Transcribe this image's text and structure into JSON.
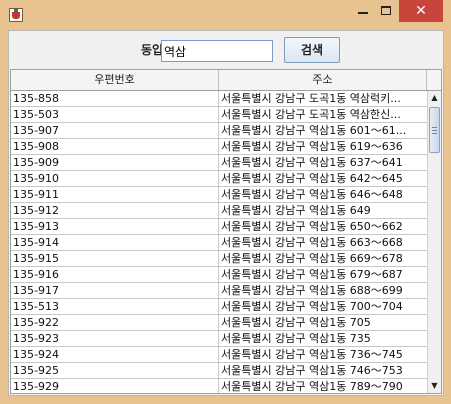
{
  "window": {
    "title": "",
    "controls": {
      "minimize": "—",
      "maximize": "□",
      "close": "✕"
    }
  },
  "search": {
    "label": "동입력:",
    "value": "역삼",
    "button_label": "검색"
  },
  "table": {
    "columns": [
      "우편번호",
      "주소"
    ],
    "rows": [
      {
        "zip": "135-858",
        "address": "서울특별시 강남구 도곡1동 역삼럭키..."
      },
      {
        "zip": "135-503",
        "address": "서울특별시 강남구 도곡1동 역삼한신..."
      },
      {
        "zip": "135-907",
        "address": "서울특별시 강남구 역삼1동 601～61..."
      },
      {
        "zip": "135-908",
        "address": "서울특별시 강남구 역삼1동 619～636"
      },
      {
        "zip": "135-909",
        "address": "서울특별시 강남구 역삼1동 637～641"
      },
      {
        "zip": "135-910",
        "address": "서울특별시 강남구 역삼1동 642～645"
      },
      {
        "zip": "135-911",
        "address": "서울특별시 강남구 역삼1동 646～648"
      },
      {
        "zip": "135-912",
        "address": "서울특별시 강남구 역삼1동 649"
      },
      {
        "zip": "135-913",
        "address": "서울특별시 강남구 역삼1동 650～662"
      },
      {
        "zip": "135-914",
        "address": "서울특별시 강남구 역삼1동 663～668"
      },
      {
        "zip": "135-915",
        "address": "서울특별시 강남구 역삼1동 669～678"
      },
      {
        "zip": "135-916",
        "address": "서울특별시 강남구 역삼1동 679～687"
      },
      {
        "zip": "135-917",
        "address": "서울특별시 강남구 역삼1동 688～699"
      },
      {
        "zip": "135-513",
        "address": "서울특별시 강남구 역삼1동 700～704"
      },
      {
        "zip": "135-922",
        "address": "서울특별시 강남구 역삼1동 705"
      },
      {
        "zip": "135-923",
        "address": "서울특별시 강남구 역삼1동 735"
      },
      {
        "zip": "135-924",
        "address": "서울특별시 강남구 역삼1동 736～745"
      },
      {
        "zip": "135-925",
        "address": "서울특별시 강남구 역삼1동 746～753"
      },
      {
        "zip": "135-929",
        "address": "서울특별시 강남구 역삼1동 789～790"
      }
    ]
  },
  "scrollbar": {
    "up_arrow": "▲",
    "down_arrow": "▼"
  },
  "colors": {
    "frame": "#e8c28f",
    "close_button": "#c8453b",
    "input_border": "#7a9cd3"
  }
}
